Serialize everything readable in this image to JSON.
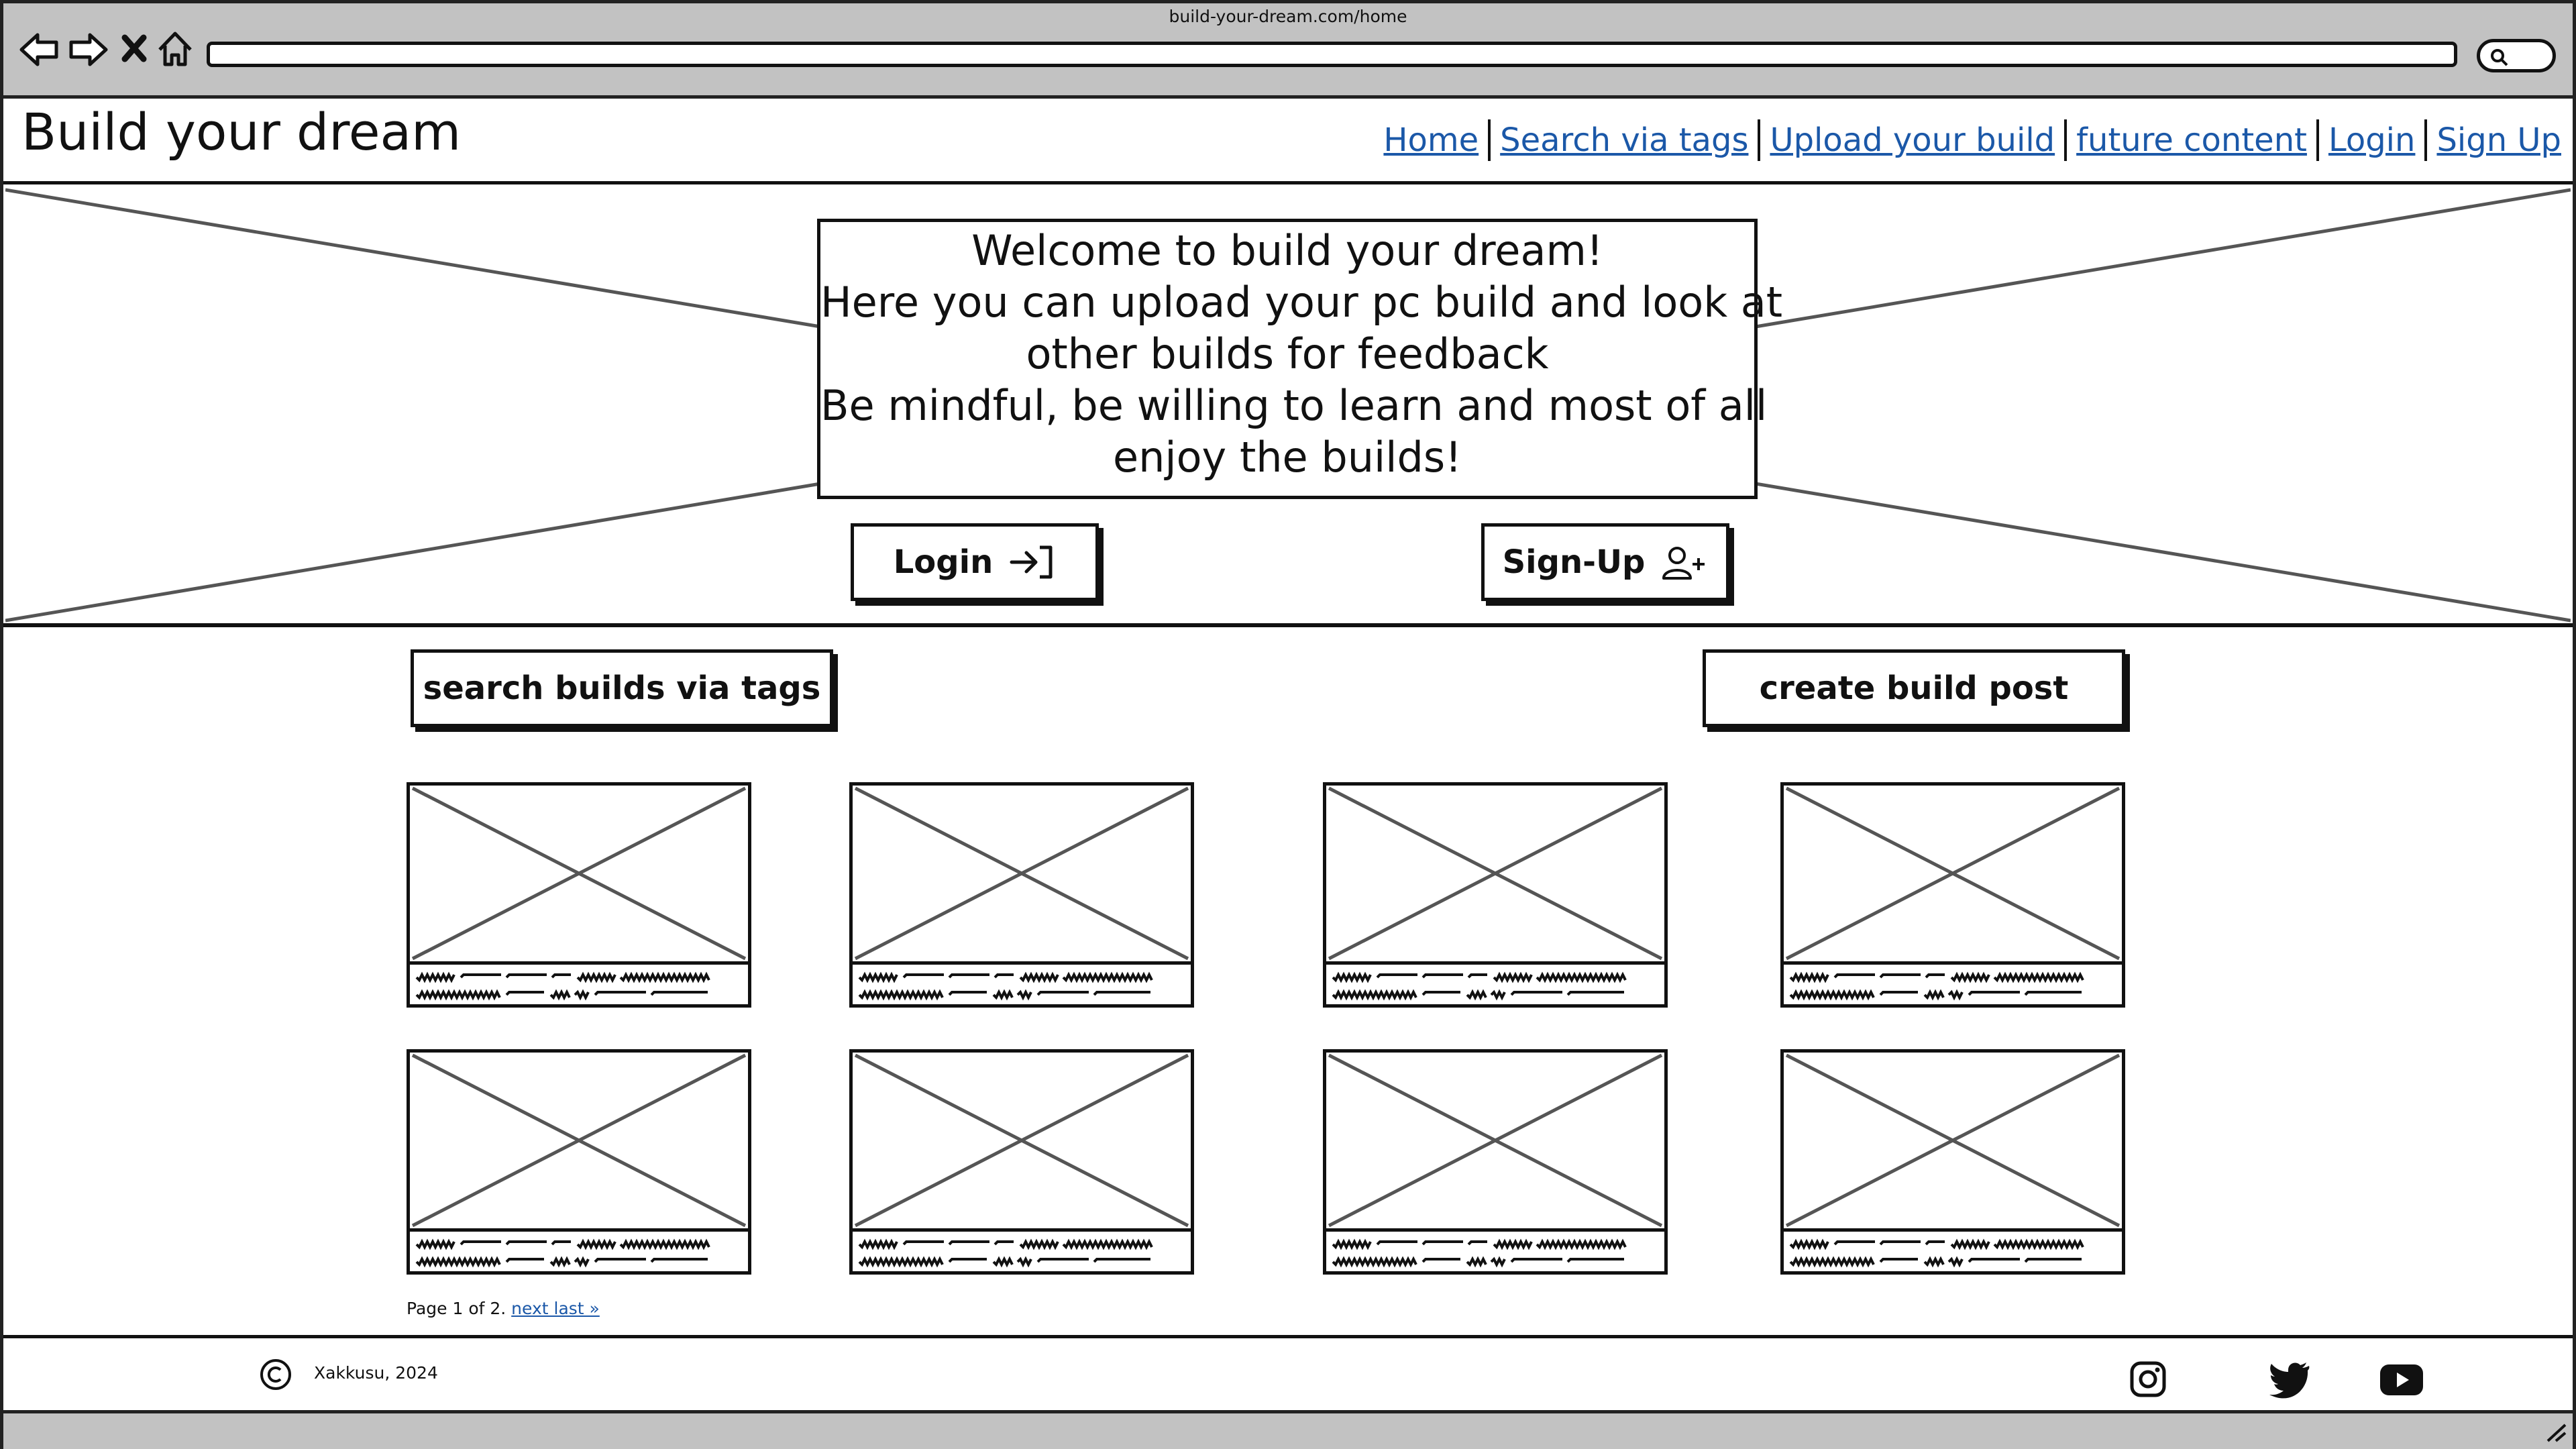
{
  "browser": {
    "url": "build-your-dream.com/home",
    "icons": [
      "back-arrow-icon",
      "forward-arrow-icon",
      "close-icon",
      "home-icon",
      "search-icon",
      "resize-grip-icon"
    ]
  },
  "header": {
    "title": "Build your dream",
    "nav": [
      "Home",
      "Search via tags",
      "Upload your build",
      "future content",
      "Login",
      "Sign Up"
    ]
  },
  "hero": {
    "welcome_lines": [
      "Welcome to build your dream!",
      "Here you can upload your pc build and look at",
      "other builds for feedback",
      "Be mindful, be willing to learn and most of all",
      "enjoy the builds!"
    ],
    "login_label": "Login",
    "signup_label": "Sign-Up"
  },
  "actions": {
    "search_tags_label": "search builds via tags",
    "create_post_label": "create build post"
  },
  "builds": {
    "rows": 2,
    "columns": 4,
    "card_count": 8
  },
  "pagination": {
    "text": "Page 1 of 2.",
    "link": "next last »"
  },
  "footer": {
    "copyright": "Xakkusu, 2024",
    "social": [
      "instagram-icon",
      "twitter-icon",
      "youtube-icon"
    ]
  },
  "colors": {
    "link": "#1b58a8",
    "chrome": "#c2c2c2",
    "ink": "#111111"
  }
}
